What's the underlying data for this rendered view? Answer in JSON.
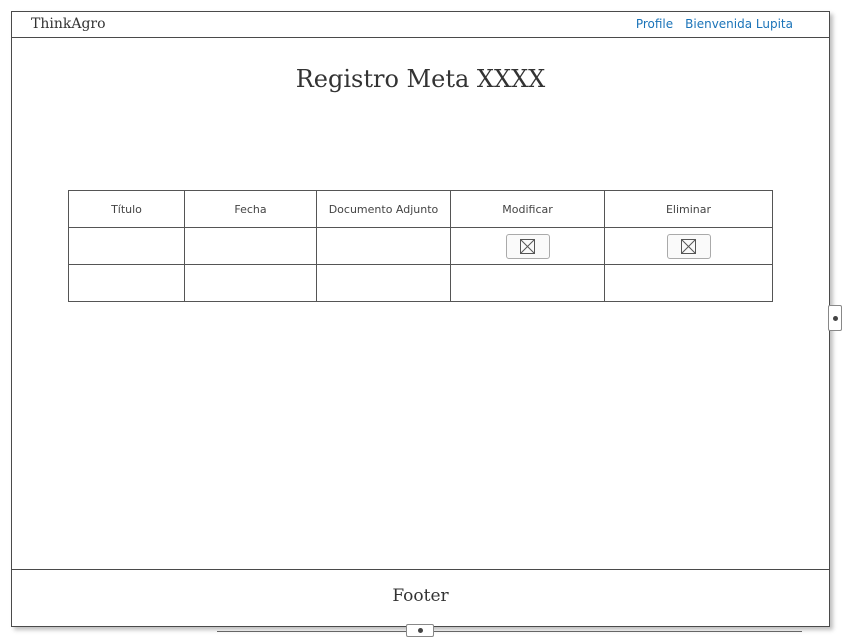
{
  "header": {
    "brand": "ThinkAgro",
    "links": [
      "Profile",
      "Bienvenida Lupita"
    ]
  },
  "page_title": "Registro Meta XXXX",
  "table": {
    "columns": [
      "Título",
      "Fecha",
      "Documento Adjunto",
      "Modificar",
      "Eliminar"
    ],
    "rows": [
      {
        "titulo": "",
        "fecha": "",
        "documento": "",
        "modificar_icon": "image-placeholder-icon",
        "eliminar_icon": "image-placeholder-icon"
      },
      {
        "titulo": "",
        "fecha": "",
        "documento": "",
        "modificar_icon": "",
        "eliminar_icon": ""
      }
    ]
  },
  "footer": {
    "label": "Footer"
  }
}
